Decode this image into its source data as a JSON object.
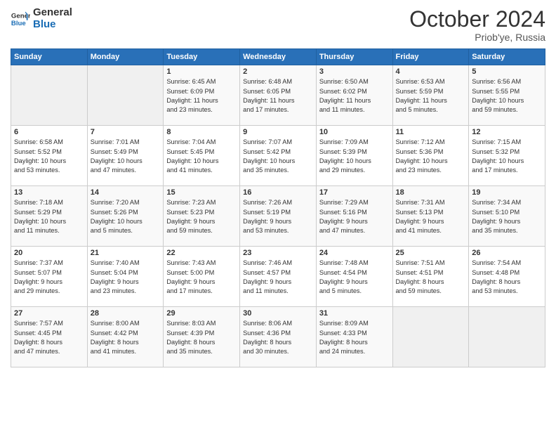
{
  "header": {
    "logo_line1": "General",
    "logo_line2": "Blue",
    "month_title": "October 2024",
    "subtitle": "Priob'ye, Russia"
  },
  "weekdays": [
    "Sunday",
    "Monday",
    "Tuesday",
    "Wednesday",
    "Thursday",
    "Friday",
    "Saturday"
  ],
  "weeks": [
    [
      {
        "day": "",
        "info": ""
      },
      {
        "day": "",
        "info": ""
      },
      {
        "day": "1",
        "info": "Sunrise: 6:45 AM\nSunset: 6:09 PM\nDaylight: 11 hours\nand 23 minutes."
      },
      {
        "day": "2",
        "info": "Sunrise: 6:48 AM\nSunset: 6:05 PM\nDaylight: 11 hours\nand 17 minutes."
      },
      {
        "day": "3",
        "info": "Sunrise: 6:50 AM\nSunset: 6:02 PM\nDaylight: 11 hours\nand 11 minutes."
      },
      {
        "day": "4",
        "info": "Sunrise: 6:53 AM\nSunset: 5:59 PM\nDaylight: 11 hours\nand 5 minutes."
      },
      {
        "day": "5",
        "info": "Sunrise: 6:56 AM\nSunset: 5:55 PM\nDaylight: 10 hours\nand 59 minutes."
      }
    ],
    [
      {
        "day": "6",
        "info": "Sunrise: 6:58 AM\nSunset: 5:52 PM\nDaylight: 10 hours\nand 53 minutes."
      },
      {
        "day": "7",
        "info": "Sunrise: 7:01 AM\nSunset: 5:49 PM\nDaylight: 10 hours\nand 47 minutes."
      },
      {
        "day": "8",
        "info": "Sunrise: 7:04 AM\nSunset: 5:45 PM\nDaylight: 10 hours\nand 41 minutes."
      },
      {
        "day": "9",
        "info": "Sunrise: 7:07 AM\nSunset: 5:42 PM\nDaylight: 10 hours\nand 35 minutes."
      },
      {
        "day": "10",
        "info": "Sunrise: 7:09 AM\nSunset: 5:39 PM\nDaylight: 10 hours\nand 29 minutes."
      },
      {
        "day": "11",
        "info": "Sunrise: 7:12 AM\nSunset: 5:36 PM\nDaylight: 10 hours\nand 23 minutes."
      },
      {
        "day": "12",
        "info": "Sunrise: 7:15 AM\nSunset: 5:32 PM\nDaylight: 10 hours\nand 17 minutes."
      }
    ],
    [
      {
        "day": "13",
        "info": "Sunrise: 7:18 AM\nSunset: 5:29 PM\nDaylight: 10 hours\nand 11 minutes."
      },
      {
        "day": "14",
        "info": "Sunrise: 7:20 AM\nSunset: 5:26 PM\nDaylight: 10 hours\nand 5 minutes."
      },
      {
        "day": "15",
        "info": "Sunrise: 7:23 AM\nSunset: 5:23 PM\nDaylight: 9 hours\nand 59 minutes."
      },
      {
        "day": "16",
        "info": "Sunrise: 7:26 AM\nSunset: 5:19 PM\nDaylight: 9 hours\nand 53 minutes."
      },
      {
        "day": "17",
        "info": "Sunrise: 7:29 AM\nSunset: 5:16 PM\nDaylight: 9 hours\nand 47 minutes."
      },
      {
        "day": "18",
        "info": "Sunrise: 7:31 AM\nSunset: 5:13 PM\nDaylight: 9 hours\nand 41 minutes."
      },
      {
        "day": "19",
        "info": "Sunrise: 7:34 AM\nSunset: 5:10 PM\nDaylight: 9 hours\nand 35 minutes."
      }
    ],
    [
      {
        "day": "20",
        "info": "Sunrise: 7:37 AM\nSunset: 5:07 PM\nDaylight: 9 hours\nand 29 minutes."
      },
      {
        "day": "21",
        "info": "Sunrise: 7:40 AM\nSunset: 5:04 PM\nDaylight: 9 hours\nand 23 minutes."
      },
      {
        "day": "22",
        "info": "Sunrise: 7:43 AM\nSunset: 5:00 PM\nDaylight: 9 hours\nand 17 minutes."
      },
      {
        "day": "23",
        "info": "Sunrise: 7:46 AM\nSunset: 4:57 PM\nDaylight: 9 hours\nand 11 minutes."
      },
      {
        "day": "24",
        "info": "Sunrise: 7:48 AM\nSunset: 4:54 PM\nDaylight: 9 hours\nand 5 minutes."
      },
      {
        "day": "25",
        "info": "Sunrise: 7:51 AM\nSunset: 4:51 PM\nDaylight: 8 hours\nand 59 minutes."
      },
      {
        "day": "26",
        "info": "Sunrise: 7:54 AM\nSunset: 4:48 PM\nDaylight: 8 hours\nand 53 minutes."
      }
    ],
    [
      {
        "day": "27",
        "info": "Sunrise: 7:57 AM\nSunset: 4:45 PM\nDaylight: 8 hours\nand 47 minutes."
      },
      {
        "day": "28",
        "info": "Sunrise: 8:00 AM\nSunset: 4:42 PM\nDaylight: 8 hours\nand 41 minutes."
      },
      {
        "day": "29",
        "info": "Sunrise: 8:03 AM\nSunset: 4:39 PM\nDaylight: 8 hours\nand 35 minutes."
      },
      {
        "day": "30",
        "info": "Sunrise: 8:06 AM\nSunset: 4:36 PM\nDaylight: 8 hours\nand 30 minutes."
      },
      {
        "day": "31",
        "info": "Sunrise: 8:09 AM\nSunset: 4:33 PM\nDaylight: 8 hours\nand 24 minutes."
      },
      {
        "day": "",
        "info": ""
      },
      {
        "day": "",
        "info": ""
      }
    ]
  ]
}
